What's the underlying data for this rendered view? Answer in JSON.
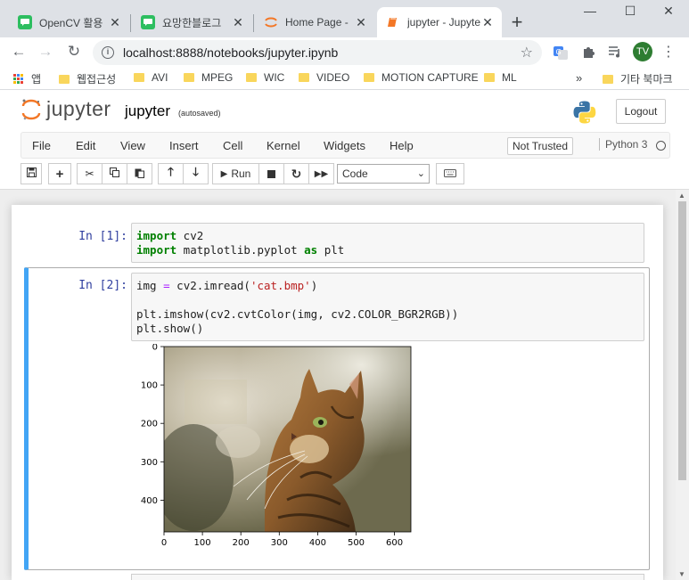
{
  "browser": {
    "tabs": [
      {
        "title": "OpenCV 활용",
        "favicon": "green-speech-bubble-icon"
      },
      {
        "title": "요망한블로그",
        "favicon": "green-speech-bubble-icon"
      },
      {
        "title": "Home Page -",
        "favicon": "jupyter-orange-icon"
      },
      {
        "title": "jupyter - Jupyter",
        "favicon": "orange-book-icon",
        "active": true
      }
    ],
    "new_tab": "+",
    "window_controls": {
      "minimize": "—",
      "maximize": "☐",
      "close": "✕"
    },
    "url": "localhost:8888/notebooks/jupyter.ipynb",
    "avatar_initials": "TV"
  },
  "bookmarks": {
    "apps_label": "앱",
    "items": [
      "웹접근성",
      "AVI",
      "MPEG",
      "WIC",
      "VIDEO",
      "MOTION CAPTURE",
      "ML"
    ],
    "overflow": "»",
    "other": "기타 북마크"
  },
  "jupyter": {
    "logo_text": "jupyter",
    "notebook_name": "jupyter",
    "autosave": "(autosaved)",
    "logout": "Logout",
    "menu": [
      "File",
      "Edit",
      "View",
      "Insert",
      "Cell",
      "Kernel",
      "Widgets",
      "Help"
    ],
    "trusted": "Not Trusted",
    "kernel": "Python 3",
    "run_label": "Run",
    "cell_type": "Code"
  },
  "cells": [
    {
      "prompt": "In [1]:",
      "lines": [
        [
          {
            "t": "import",
            "c": "kw"
          },
          {
            "t": " cv2",
            "c": ""
          }
        ],
        [
          {
            "t": "import",
            "c": "kw"
          },
          {
            "t": " matplotlib.pyplot ",
            "c": ""
          },
          {
            "t": "as",
            "c": "kw"
          },
          {
            "t": " plt",
            "c": ""
          }
        ]
      ]
    },
    {
      "prompt": "In [2]:",
      "lines": [
        [
          {
            "t": "img ",
            "c": ""
          },
          {
            "t": "=",
            "c": "op"
          },
          {
            "t": " cv2.imread(",
            "c": ""
          },
          {
            "t": "'cat.bmp'",
            "c": "str"
          },
          {
            "t": ")",
            "c": ""
          }
        ],
        [],
        [
          {
            "t": "plt.imshow(cv2.cvtColor(img, cv2.COLOR_BGR2RGB))",
            "c": ""
          }
        ],
        [
          {
            "t": "plt.show()",
            "c": ""
          }
        ]
      ]
    }
  ],
  "plot": {
    "x_ticks": [
      "0",
      "100",
      "200",
      "300",
      "400",
      "500",
      "600"
    ],
    "y_ticks": [
      "0",
      "100",
      "200",
      "300",
      "400"
    ]
  }
}
